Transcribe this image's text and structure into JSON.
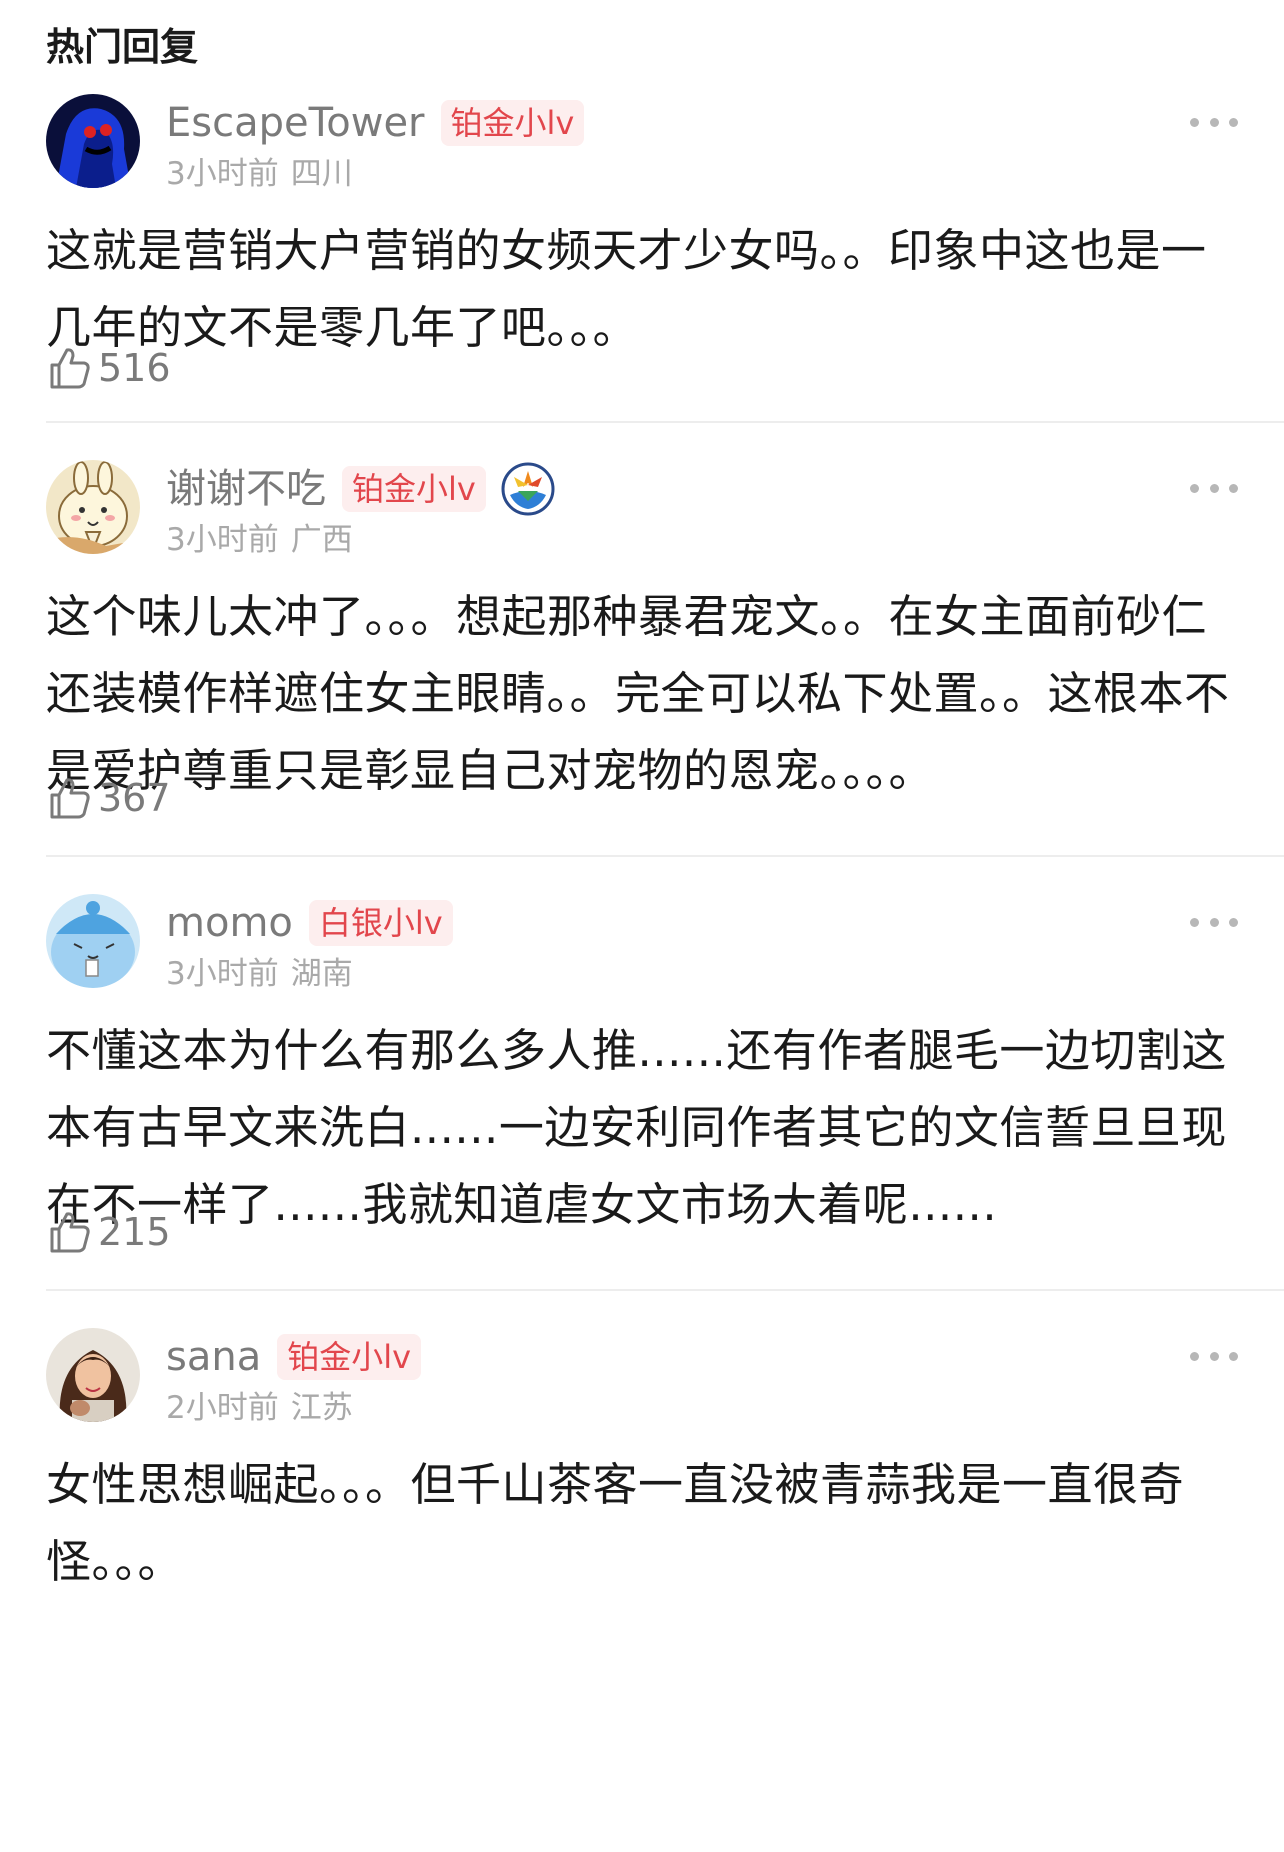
{
  "header": {
    "title": "热门回复"
  },
  "comments": [
    {
      "username": "EscapeTower",
      "badge": "铂金小lv",
      "time": "3小时前",
      "location": "四川",
      "text": "这就是营销大户营销的女频天才少女吗。。印象中这也是一几年的文不是零几年了吧。。。",
      "likes": "516",
      "verified": false
    },
    {
      "username": "谢谢不吃",
      "badge": "铂金小lv",
      "time": "3小时前",
      "location": "广西",
      "text": "这个味儿太冲了。。。想起那种暴君宠文。。在女主面前砂仁还装模作样遮住女主眼睛。。完全可以私下处置。。这根本不是爱护尊重只是彰显自己对宠物的恩宠。。。。",
      "likes": "367",
      "verified": true
    },
    {
      "username": "momo",
      "badge": "白银小lv",
      "time": "3小时前",
      "location": "湖南",
      "text": "不懂这本为什么有那么多人推......还有作者腿毛一边切割这本有古早文来洗白......一边安利同作者其它的文信誓旦旦现在不一样了......我就知道虐女文市场大着呢......",
      "likes": "215",
      "verified": false
    },
    {
      "username": "sana",
      "badge": "铂金小lv",
      "time": "2小时前",
      "location": "江苏",
      "text": "女性思想崛起。。。但千山茶客一直没被青蒜我是一直很奇怪。。。",
      "likes": "",
      "verified": false
    }
  ],
  "colors": {
    "badge_text": "#e2464c",
    "badge_bg": "#fdeeee",
    "meta": "#a9a9a9",
    "username": "#7a7a7a"
  },
  "icons": {
    "like": "thumbs-up-icon",
    "more": "more-icon",
    "verify": "verified-badge-icon"
  }
}
